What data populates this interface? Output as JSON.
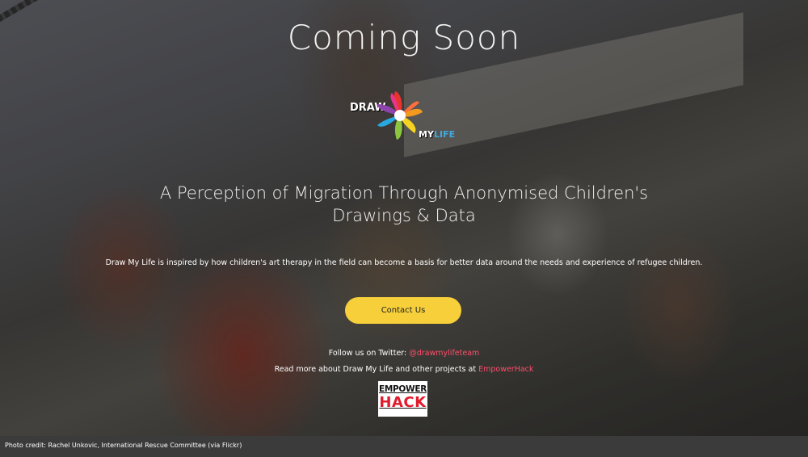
{
  "hero": {
    "title": "Coming Soon",
    "logo": {
      "word1": "DRAW",
      "word2": "MY",
      "word3": "LIFE"
    },
    "subtitle": "A Perception of Migration Through Anonymised Children's Drawings & Data",
    "description": "Draw My Life is inspired by how children's art therapy in the field can become a basis for better data around the needs and experience of refugee children.",
    "contact_label": "Contact Us",
    "follow": {
      "prefix": "Follow us on Twitter: ",
      "handle": "@drawmylifeteam"
    },
    "readmore": {
      "prefix": "Read more about Draw My Life and other projects at ",
      "link": "EmpowerHack"
    },
    "empower_logo": {
      "top": "EMPOWER",
      "bottom": "HACK"
    }
  },
  "footer": {
    "credit": "Photo credit: Rachel Unkovic, International Rescue Committee (via Flickr)"
  },
  "colors": {
    "accent_button": "#f6cf3a",
    "link": "#ff4d6a",
    "footer_bg": "#3b3b3b"
  }
}
